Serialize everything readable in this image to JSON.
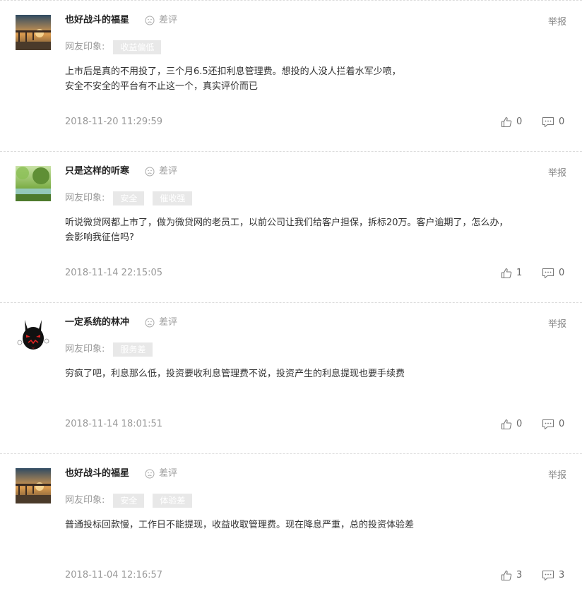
{
  "report_label": "举报",
  "impression_label": "网友印象:",
  "comments": [
    {
      "username": "也好战斗的福星",
      "rating": "差评",
      "avatar": "sunset-pier-avatar",
      "tags": [
        "收益偏低"
      ],
      "text": [
        "上市后是真的不用投了，三个月6.5还扣利息管理费。想投的人没人拦着水军少喷，",
        "安全不安全的平台有不止这一个，真实评价而已"
      ],
      "date": "2018-11-20 11:29:59",
      "likes": "0",
      "replies": "0"
    },
    {
      "username": "只是这样的听寒",
      "rating": "差评",
      "avatar": "forest-lake-avatar",
      "tags": [
        "安全",
        "催收强"
      ],
      "text": [
        "听说微贷网都上市了，做为微贷网的老员工，以前公司让我们给客户担保，拆标20万。客户逾期了，怎么办，",
        "会影响我征信吗?"
      ],
      "date": "2018-11-14 22:15:05",
      "likes": "1",
      "replies": "0"
    },
    {
      "username": "一定系统的林冲",
      "rating": "差评",
      "avatar": "black-rabbit-avatar",
      "tags": [
        "服务差"
      ],
      "text": [
        "穷疯了吧，利息那么低，投资要收利息管理费不说，投资产生的利息提现也要手续费"
      ],
      "date": "2018-11-14 18:01:51",
      "likes": "0",
      "replies": "0"
    },
    {
      "username": "也好战斗的福星",
      "rating": "差评",
      "avatar": "sunset-pier-avatar",
      "tags": [
        "安全",
        "体验差"
      ],
      "text": [
        "普通投标回款慢，工作日不能提现，收益收取管理费。现在降息严重，总的投资体验差"
      ],
      "date": "2018-11-04 12:16:57",
      "likes": "3",
      "replies": "3"
    }
  ]
}
